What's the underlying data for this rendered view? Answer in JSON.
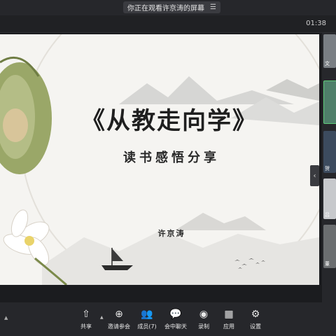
{
  "top": {
    "share_banner": "你正在观看许京涛的屏幕",
    "banner_icon": "menu-icon",
    "timer": "01:38"
  },
  "slide": {
    "title": "《从教走向学》",
    "subtitle": "读书感悟分享",
    "author": "许京涛"
  },
  "participants": [
    {
      "label": "文"
    },
    {
      "label": ""
    },
    {
      "label": "贺"
    },
    {
      "label": "吕"
    },
    {
      "label": "董"
    }
  ],
  "toolbar": {
    "items": [
      {
        "label": "共享",
        "icon": "share-screen-icon"
      },
      {
        "label": "邀请参会",
        "icon": "invite-icon"
      },
      {
        "label": "成员(7)",
        "icon": "members-icon"
      },
      {
        "label": "会中聊天",
        "icon": "chat-icon"
      },
      {
        "label": "录制",
        "icon": "record-icon"
      },
      {
        "label": "应用",
        "icon": "apps-icon"
      },
      {
        "label": "设置",
        "icon": "settings-icon"
      }
    ]
  },
  "colors": {
    "bar": "#26272b",
    "slide_bg": "#f5f4f1",
    "ink": "#1f1f1f",
    "lotus_green": "#8fa05c"
  }
}
